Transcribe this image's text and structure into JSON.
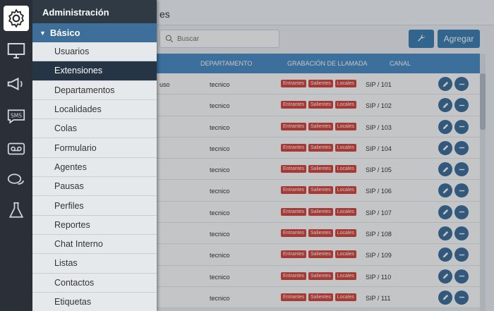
{
  "topbar": {
    "title_fragment": "es"
  },
  "search": {
    "placeholder": "Buscar"
  },
  "toolbar": {
    "add_label": "Agregar"
  },
  "table": {
    "headers": {
      "departamento": "DEPARTAMENTO",
      "grabacion": "GRABACIÓN DE LLAMADA",
      "canal": "CANAL"
    },
    "badges": [
      "Entrantes",
      "Salientes",
      "Locales"
    ],
    "rows": [
      {
        "user": "uso",
        "dept": "tecnico",
        "canal": "SIP / 101"
      },
      {
        "user": "",
        "dept": "tecnico",
        "canal": "SIP / 102"
      },
      {
        "user": "",
        "dept": "tecnico",
        "canal": "SIP / 103"
      },
      {
        "user": "",
        "dept": "tecnico",
        "canal": "SIP / 104"
      },
      {
        "user": "",
        "dept": "tecnico",
        "canal": "SIP / 105"
      },
      {
        "user": "",
        "dept": "tecnico",
        "canal": "SIP / 106"
      },
      {
        "user": "",
        "dept": "tecnico",
        "canal": "SIP / 107"
      },
      {
        "user": "",
        "dept": "tecnico",
        "canal": "SIP / 108"
      },
      {
        "user": "",
        "dept": "tecnico",
        "canal": "SIP / 109"
      },
      {
        "user": "",
        "dept": "tecnico",
        "canal": "SIP / 110"
      },
      {
        "user": "",
        "dept": "tecnico",
        "canal": "SIP / 111"
      }
    ]
  },
  "menu": {
    "header": "Administración",
    "section": "Básico",
    "items": [
      "Usuarios",
      "Extensiones",
      "Departamentos",
      "Localidades",
      "Colas",
      "Formulario",
      "Agentes",
      "Pausas",
      "Perfiles",
      "Reportes",
      "Chat Interno",
      "Listas",
      "Contactos",
      "Etiquetas"
    ],
    "active_item": "Extensiones"
  },
  "rail": {
    "icons": [
      "gear-icon",
      "monitor-icon",
      "megaphone-icon",
      "sms-icon",
      "voicemail-icon",
      "chat-icon",
      "flask-icon"
    ],
    "sms_text": "SMS"
  },
  "colors": {
    "accent": "#3d7fb3",
    "badge": "#d9453d",
    "menu_active": "#253546"
  }
}
